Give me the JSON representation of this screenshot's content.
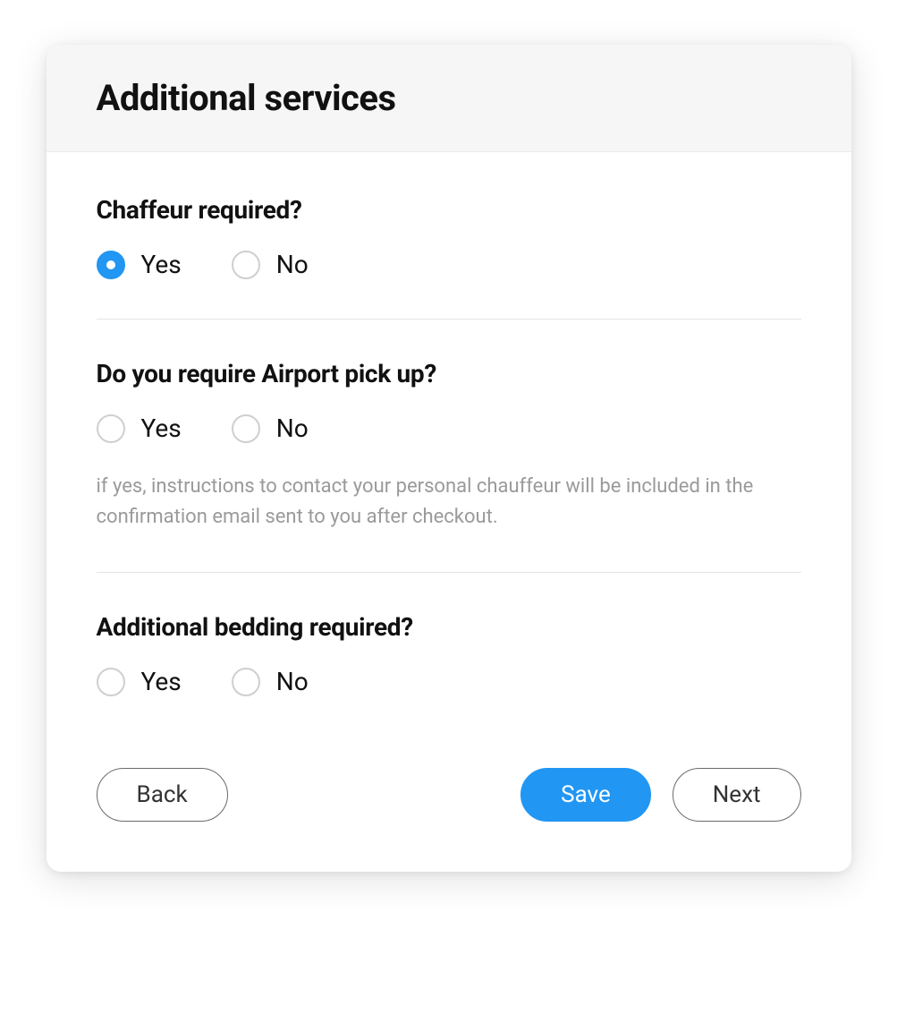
{
  "header": {
    "title": "Additional services"
  },
  "questions": [
    {
      "label": "Chaffeur required?",
      "options": [
        "Yes",
        "No"
      ],
      "selected": "Yes",
      "help": null
    },
    {
      "label": "Do you require Airport pick up?",
      "options": [
        "Yes",
        "No"
      ],
      "selected": null,
      "help": "if yes, instructions to contact your personal chauffeur will be included in the confirmation email sent to you after checkout."
    },
    {
      "label": "Additional bedding required?",
      "options": [
        "Yes",
        "No"
      ],
      "selected": null,
      "help": null
    }
  ],
  "buttons": {
    "back": "Back",
    "save": "Save",
    "next": "Next"
  }
}
